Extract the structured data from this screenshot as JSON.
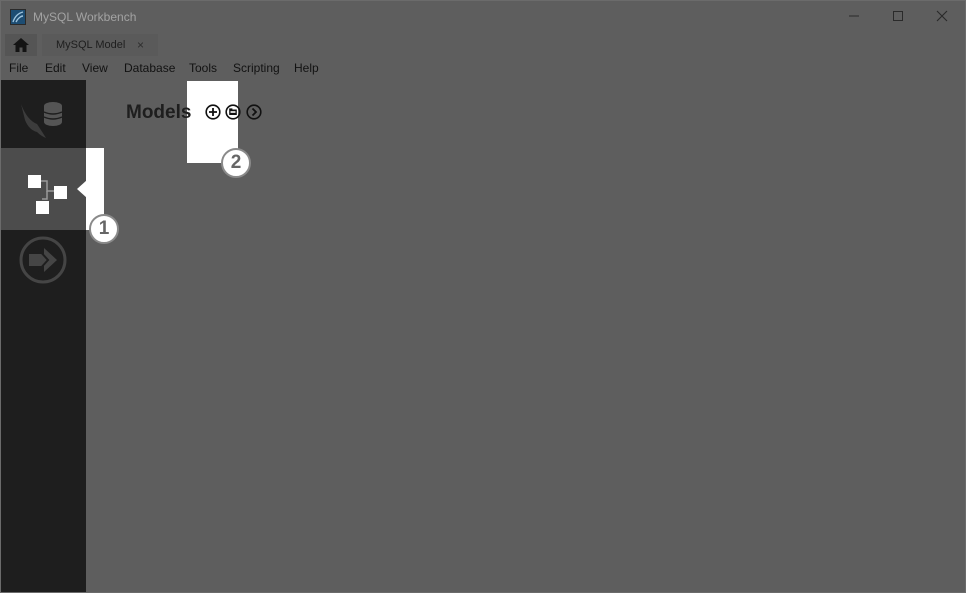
{
  "window": {
    "title": "MySQL Workbench",
    "controls": {
      "minimize": "minimize-icon",
      "maximize": "maximize-icon",
      "close": "close-icon"
    }
  },
  "tabs": {
    "home_icon": "home-icon",
    "items": [
      {
        "label": "MySQL Model",
        "close": "×"
      }
    ]
  },
  "menu": {
    "items": [
      "File",
      "Edit",
      "View",
      "Database",
      "Tools",
      "Scripting",
      "Help"
    ]
  },
  "sidebar": {
    "items": [
      {
        "name": "connections",
        "icon": "dolphin-database-icon"
      },
      {
        "name": "models",
        "icon": "models-diagram-icon",
        "selected": true
      },
      {
        "name": "migration",
        "icon": "migration-arrow-icon"
      }
    ]
  },
  "main": {
    "title": "Models",
    "actions": [
      {
        "icon": "add-circle-icon"
      },
      {
        "icon": "open-folder-circle-icon"
      },
      {
        "icon": "chevron-right-circle-icon"
      }
    ]
  },
  "callouts": [
    "1",
    "2"
  ],
  "colors": {
    "overlay": "#5e5e5e",
    "sidebar": "#1e1e1e",
    "highlight": "#ffffff"
  }
}
